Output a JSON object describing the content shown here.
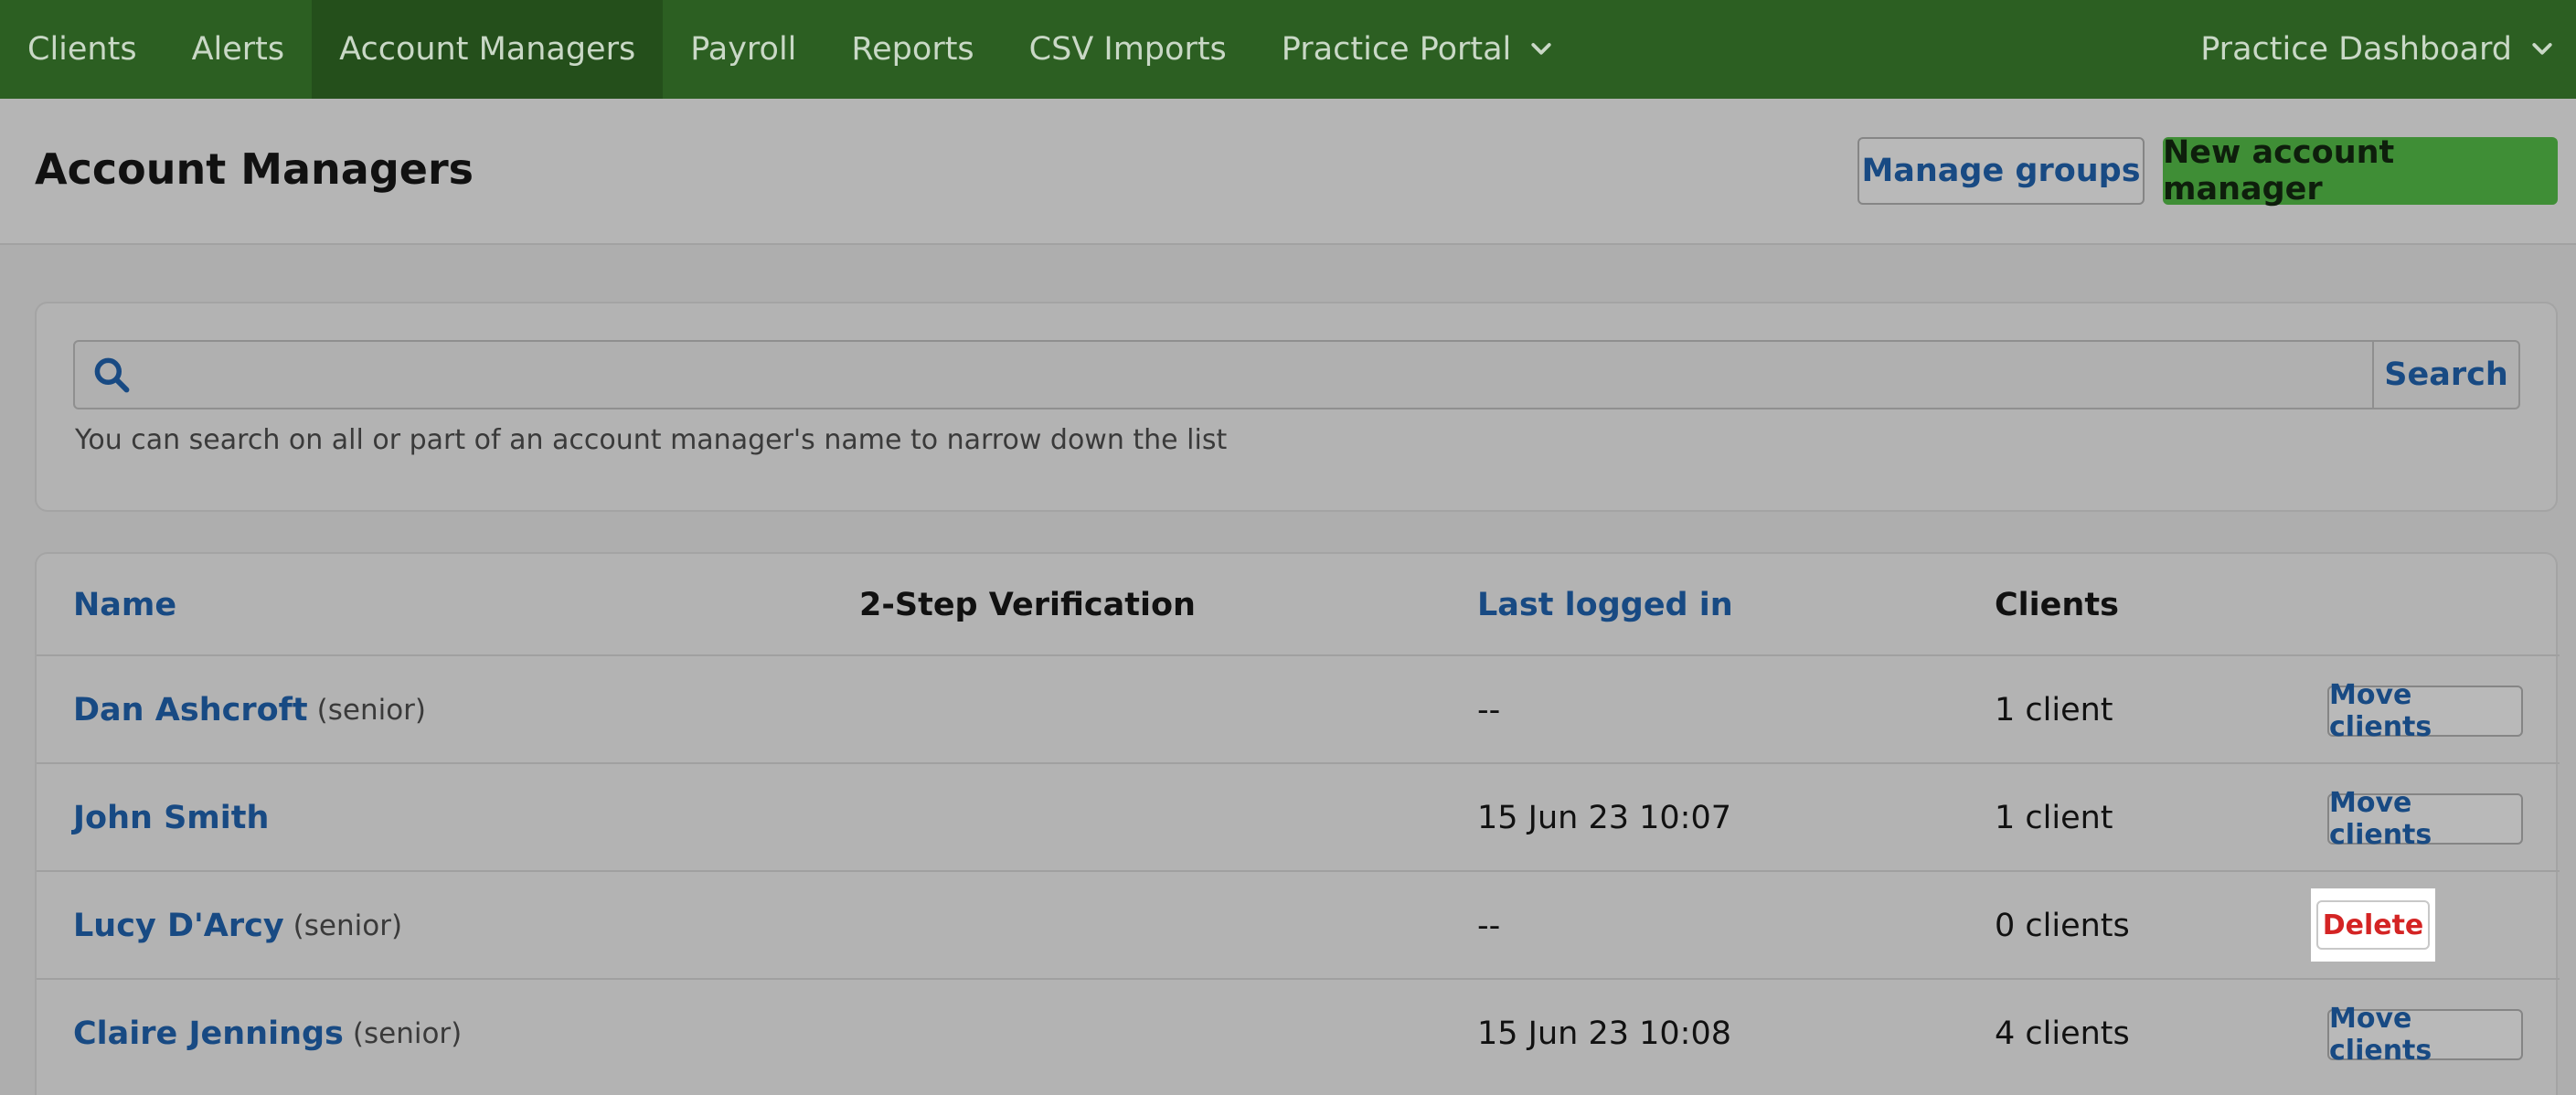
{
  "nav": {
    "items": [
      {
        "label": "Clients"
      },
      {
        "label": "Alerts"
      },
      {
        "label": "Account Managers"
      },
      {
        "label": "Payroll"
      },
      {
        "label": "Reports"
      },
      {
        "label": "CSV Imports"
      },
      {
        "label": "Practice Portal"
      }
    ],
    "active": "Account Managers",
    "right_label": "Practice Dashboard"
  },
  "header": {
    "title": "Account Managers",
    "manage_groups_label": "Manage groups",
    "new_manager_label": "New account manager"
  },
  "search": {
    "value": "",
    "placeholder": "",
    "button_label": "Search",
    "hint": "You can search on all or part of an account manager's name to narrow down the list"
  },
  "table": {
    "headers": {
      "name": "Name",
      "two_step": "2-Step Verification",
      "last_logged_in": "Last logged in",
      "clients": "Clients"
    },
    "rows": [
      {
        "name": "Dan Ashcroft",
        "role": "(senior)",
        "two_step": "",
        "last_logged_in": "--",
        "clients": "1 client",
        "action": "Move clients"
      },
      {
        "name": "John Smith",
        "role": "",
        "two_step": "",
        "last_logged_in": "15 Jun 23 10:07",
        "clients": "1 client",
        "action": "Move clients"
      },
      {
        "name": "Lucy D'Arcy",
        "role": "(senior)",
        "two_step": "",
        "last_logged_in": "--",
        "clients": "0 clients",
        "action": "Delete"
      },
      {
        "name": "Claire Jennings",
        "role": "(senior)",
        "two_step": "",
        "last_logged_in": "15 Jun 23 10:08",
        "clients": "4 clients",
        "action": "Move clients"
      }
    ]
  },
  "colors": {
    "nav_bg": "#2c5f22",
    "nav_active_bg": "#244f1b",
    "link_blue": "#184a83",
    "primary_green": "#3f8e36",
    "danger_red": "#d42424"
  }
}
